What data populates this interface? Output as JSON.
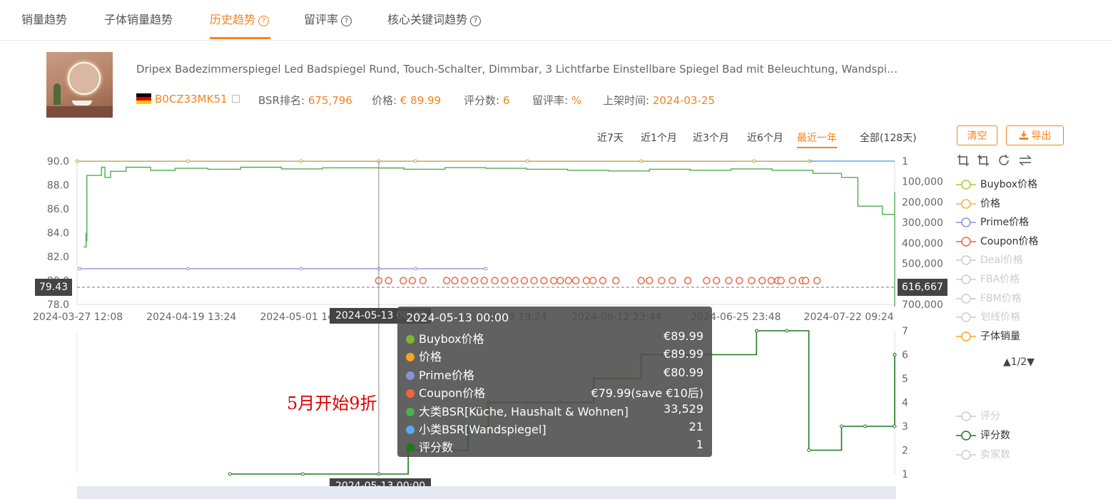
{
  "tabs": [
    {
      "label": "销量趋势",
      "help": false,
      "active": false
    },
    {
      "label": "子体销量趋势",
      "help": false,
      "active": false
    },
    {
      "label": "历史趋势",
      "help": true,
      "active": true
    },
    {
      "label": "留评率",
      "help": true,
      "active": false
    },
    {
      "label": "核心关键词趋势",
      "help": true,
      "active": false
    }
  ],
  "product": {
    "title": "Dripex Badezimmerspiegel Led Badspiegel Rund, Touch-Schalter, Dimmbar, 3 Lichtfarbe Einstellbare Spiegel Bad mit Beleuchtung, Wandspi…",
    "asin": "B0CZ33MK51",
    "bsr_label": "BSR排名:",
    "bsr_value": "675,796",
    "price_label": "价格:",
    "price_value": "€ 89.99",
    "rating_count_label": "评分数:",
    "rating_count_value": "6",
    "review_rate_label": "留评率:",
    "review_rate_value": "%",
    "launch_label": "上架时间:",
    "launch_value": "2024-03-25"
  },
  "ranges": [
    "近7天",
    "近1个月",
    "近3个月",
    "近6个月",
    "最近一年",
    "全部(128天)"
  ],
  "active_range": "最近一年",
  "buttons": {
    "clear": "清空",
    "export": "导出"
  },
  "tool_icons": [
    "crop-zoom-icon",
    "crop-reset-icon",
    "refresh-icon",
    "swap-icon"
  ],
  "legend_page": "▲1/2▼",
  "tooltip": {
    "header": "2024-05-13 00:00",
    "rows": [
      {
        "label": "Buybox价格",
        "value": "€89.99",
        "color": "#7cb82f"
      },
      {
        "label": "价格",
        "value": "€89.99",
        "color": "#f5a623"
      },
      {
        "label": "Prime价格",
        "value": "€80.99",
        "color": "#8b93d6"
      },
      {
        "label": "Coupon价格",
        "value": "€79.99(save €10后)",
        "color": "#f0643c"
      },
      {
        "label": "大类BSR[Küche, Haushalt & Wohnen]",
        "value": "33,529",
        "color": "#4caf50"
      },
      {
        "label": "小类BSR[Wandspiegel]",
        "value": "21",
        "color": "#5aa8f0"
      },
      {
        "label": "评分数",
        "value": "1",
        "color": "#1a7a1a"
      }
    ]
  },
  "cursor": {
    "x_label": "2024-05-13 00:00",
    "y_left": "79.43",
    "y_right": "616,667"
  },
  "annotation": "5月开始9折",
  "chart_data": [
    {
      "type": "line",
      "x_tick_labels": [
        "2024-03-27 12:08",
        "2024-04-19 13:24",
        "2024-05-01 14",
        "2024-05-29 19:24",
        "2024-06-12 23:44",
        "2024-06-25 23:48",
        "2024-07-22 09:24"
      ],
      "left_axis": {
        "ticks": [
          "90.0",
          "88.0",
          "86.0",
          "84.0",
          "82.0",
          "80.0",
          "78.0"
        ],
        "ylim": [
          78,
          90
        ]
      },
      "right_axis": {
        "ticks": [
          "1",
          "100,000",
          "200,000",
          "300,000",
          "400,000",
          "500,000",
          "600,000",
          "700,000"
        ],
        "ylim": [
          1,
          700000
        ],
        "inverted": true
      },
      "series": [
        {
          "name": "Buybox价格",
          "color": "#b8a44c",
          "axis": "left",
          "points": [
            [
              0,
              89.99
            ],
            [
              0.136,
              89.99
            ],
            [
              0.274,
              89.99
            ],
            [
              0.369,
              89.99
            ],
            [
              0.414,
              89.99
            ],
            [
              0.551,
              89.99
            ],
            [
              0.69,
              89.99
            ],
            [
              0.828,
              89.99
            ],
            [
              0.896,
              89.99
            ]
          ]
        },
        {
          "name": "价格",
          "color": "#f5a623",
          "axis": "left",
          "points": []
        },
        {
          "name": "Prime价格",
          "color": "#8b93d6",
          "axis": "left",
          "points": [
            [
              0.003,
              80.99
            ],
            [
              0.136,
              80.99
            ],
            [
              0.274,
              80.99
            ],
            [
              0.369,
              80.99
            ],
            [
              0.414,
              80.99
            ],
            [
              0.5,
              80.99
            ]
          ]
        },
        {
          "name": "Coupon价格",
          "color": "#f0643c",
          "axis": "left",
          "points": [
            [
              0.369,
              79.99
            ],
            [
              0.381,
              79.99
            ],
            [
              0.399,
              79.99
            ],
            [
              0.41,
              79.99
            ],
            [
              0.423,
              79.99
            ],
            [
              0.452,
              79.99
            ],
            [
              0.462,
              79.99
            ],
            [
              0.474,
              79.99
            ],
            [
              0.486,
              79.99
            ],
            [
              0.498,
              79.99
            ],
            [
              0.511,
              79.99
            ],
            [
              0.523,
              79.99
            ],
            [
              0.535,
              79.99
            ],
            [
              0.547,
              79.99
            ],
            [
              0.559,
              79.99
            ],
            [
              0.571,
              79.99
            ],
            [
              0.583,
              79.99
            ],
            [
              0.591,
              79.99
            ],
            [
              0.601,
              79.99
            ],
            [
              0.61,
              79.99
            ],
            [
              0.623,
              79.99
            ],
            [
              0.631,
              79.99
            ],
            [
              0.643,
              79.99
            ],
            [
              0.659,
              79.99
            ],
            [
              0.69,
              79.99
            ],
            [
              0.7,
              79.99
            ],
            [
              0.715,
              79.99
            ],
            [
              0.728,
              79.99
            ],
            [
              0.747,
              79.99
            ],
            [
              0.77,
              79.99
            ],
            [
              0.782,
              79.99
            ],
            [
              0.797,
              79.99
            ],
            [
              0.81,
              79.99
            ],
            [
              0.825,
              79.99
            ],
            [
              0.838,
              79.99
            ],
            [
              0.849,
              79.99
            ],
            [
              0.857,
              79.99
            ],
            [
              0.861,
              79.99
            ],
            [
              0.875,
              79.99
            ],
            [
              0.887,
              79.99
            ],
            [
              0.891,
              79.99
            ],
            [
              0.905,
              79.99
            ]
          ]
        },
        {
          "name": "大类BSR[Küche, Haushalt & Wohnen]",
          "color": "#4caf50",
          "axis": "right",
          "step": true,
          "points": [
            [
              0.008,
              420000
            ],
            [
              0.011,
              350000
            ],
            [
              0.011,
              390000
            ],
            [
              0.012,
              70000
            ],
            [
              0.03,
              30000
            ],
            [
              0.034,
              80000
            ],
            [
              0.041,
              50000
            ],
            [
              0.06,
              30000
            ],
            [
              0.09,
              45000
            ],
            [
              0.12,
              35000
            ],
            [
              0.16,
              40000
            ],
            [
              0.2,
              30000
            ],
            [
              0.25,
              38000
            ],
            [
              0.3,
              33000
            ],
            [
              0.369,
              33529
            ],
            [
              0.4,
              40000
            ],
            [
              0.45,
              32000
            ],
            [
              0.5,
              35000
            ],
            [
              0.55,
              40000
            ],
            [
              0.6,
              45000
            ],
            [
              0.65,
              48000
            ],
            [
              0.7,
              40000
            ],
            [
              0.75,
              45000
            ],
            [
              0.8,
              38000
            ],
            [
              0.85,
              45000
            ],
            [
              0.9,
              60000
            ],
            [
              0.935,
              80000
            ],
            [
              0.955,
              220000
            ],
            [
              0.985,
              260000
            ],
            [
              1.0,
              290000
            ],
            [
              1.012,
              300000
            ],
            [
              1.018,
              150000
            ],
            [
              1.026,
              270000
            ],
            [
              1.036,
              370000
            ],
            [
              1.06,
              430000
            ],
            [
              1.1,
              520000
            ],
            [
              1.13,
              630000
            ],
            [
              1.15,
              690000
            ],
            [
              1.167,
              710000
            ]
          ]
        },
        {
          "name": "小类BSR[Wandspiegel]",
          "color": "#5aa8f0",
          "axis": "right",
          "points": [
            [
              0.896,
              21
            ],
            [
              0.96,
              21
            ],
            [
              1.0,
              21
            ]
          ]
        }
      ]
    },
    {
      "type": "line",
      "y_axis": {
        "ticks": [
          "7",
          "6",
          "5",
          "4",
          "3",
          "2",
          "1"
        ],
        "ylim": [
          1,
          7
        ]
      },
      "series": [
        {
          "name": "评分数",
          "color": "#1a7a1a",
          "step": true,
          "points": [
            [
              0.187,
              1
            ],
            [
              0.276,
              1
            ],
            [
              0.369,
              1
            ],
            [
              0.405,
              2
            ],
            [
              0.443,
              2
            ],
            [
              0.478,
              3
            ],
            [
              0.503,
              4
            ],
            [
              0.55,
              4
            ],
            [
              0.59,
              4
            ],
            [
              0.632,
              5
            ],
            [
              0.69,
              6
            ],
            [
              0.775,
              6
            ],
            [
              0.831,
              7
            ],
            [
              0.868,
              7
            ],
            [
              0.895,
              2
            ],
            [
              0.935,
              3
            ],
            [
              0.964,
              3
            ],
            [
              1.0,
              3
            ],
            [
              1.004,
              6
            ],
            [
              1.02,
              6
            ]
          ]
        }
      ]
    }
  ],
  "legend": [
    {
      "label": "Buybox价格",
      "color": "#a8c93a",
      "on": true
    },
    {
      "label": "价格",
      "color": "#f5b33a",
      "on": true
    },
    {
      "label": "Prime价格",
      "color": "#8b93d6",
      "on": true
    },
    {
      "label": "Coupon价格",
      "color": "#f0643c",
      "on": true
    },
    {
      "label": "Deal价格",
      "color": "#cccccc",
      "on": false
    },
    {
      "label": "FBA价格",
      "color": "#cccccc",
      "on": false
    },
    {
      "label": "FBM价格",
      "color": "#cccccc",
      "on": false
    },
    {
      "label": "划线价格",
      "color": "#cccccc",
      "on": false
    },
    {
      "label": "子体销量",
      "color": "#f5a623",
      "on": true
    }
  ],
  "legend2": [
    {
      "label": "评分",
      "color": "#cccccc",
      "on": false
    },
    {
      "label": "评分数",
      "color": "#1a7a1a",
      "on": true
    },
    {
      "label": "卖家数",
      "color": "#cccccc",
      "on": false
    }
  ]
}
